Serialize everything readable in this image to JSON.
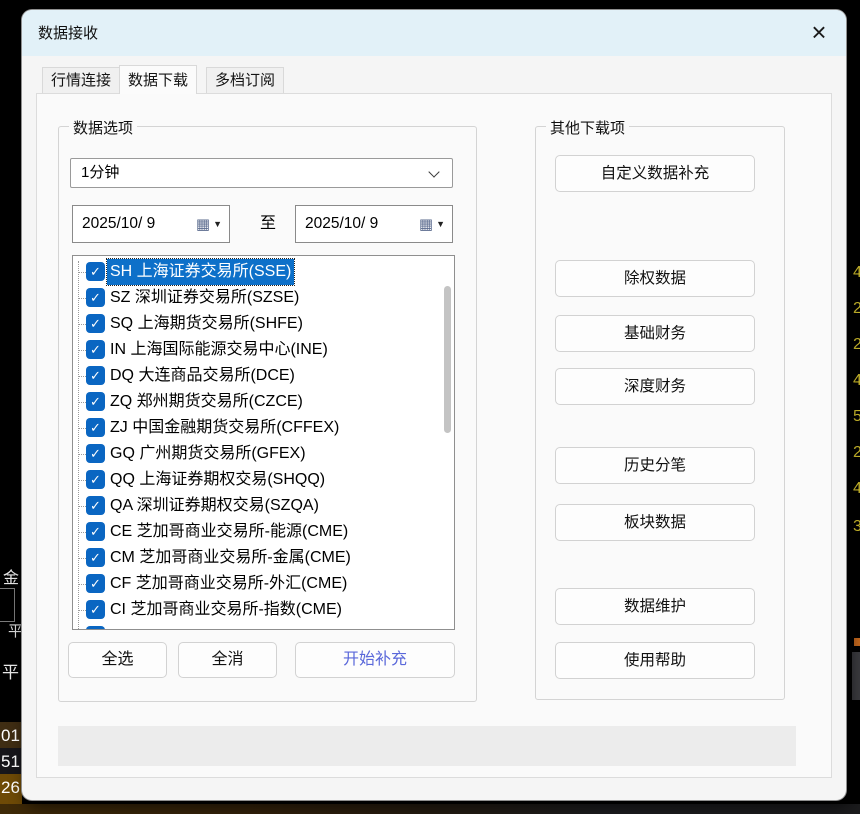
{
  "window": {
    "title": "数据接收",
    "close_glyph": "×"
  },
  "tabs": {
    "items": [
      {
        "label": "行情连接",
        "active": false
      },
      {
        "label": "数据下载",
        "active": true
      },
      {
        "label": "多档订阅",
        "active": false
      }
    ]
  },
  "data_options": {
    "legend": "数据选项",
    "period": {
      "value": "1分钟"
    },
    "dates": {
      "from": "2025/10/ 9",
      "to_label": "至",
      "to": "2025/10/ 9"
    },
    "exchanges": [
      {
        "label": "SH 上海证券交易所(SSE)",
        "checked": true,
        "selected": true
      },
      {
        "label": "SZ 深圳证券交易所(SZSE)",
        "checked": true,
        "selected": false
      },
      {
        "label": "SQ 上海期货交易所(SHFE)",
        "checked": true,
        "selected": false
      },
      {
        "label": "IN 上海国际能源交易中心(INE)",
        "checked": true,
        "selected": false
      },
      {
        "label": "DQ 大连商品交易所(DCE)",
        "checked": true,
        "selected": false
      },
      {
        "label": "ZQ 郑州期货交易所(CZCE)",
        "checked": true,
        "selected": false
      },
      {
        "label": "ZJ 中国金融期货交易所(CFFEX)",
        "checked": true,
        "selected": false
      },
      {
        "label": "GQ 广州期货交易所(GFEX)",
        "checked": true,
        "selected": false
      },
      {
        "label": "QQ 上海证券期权交易(SHQQ)",
        "checked": true,
        "selected": false
      },
      {
        "label": "QA 深圳证券期权交易(SZQA)",
        "checked": true,
        "selected": false
      },
      {
        "label": "CE 芝加哥商业交易所-能源(CME)",
        "checked": true,
        "selected": false
      },
      {
        "label": "CM 芝加哥商业交易所-金属(CME)",
        "checked": true,
        "selected": false
      },
      {
        "label": "CF 芝加哥商业交易所-外汇(CME)",
        "checked": true,
        "selected": false
      },
      {
        "label": "CI 芝加哥商业交易所-指数(CME)",
        "checked": true,
        "selected": false
      }
    ],
    "actions": {
      "select_all": "全选",
      "clear_all": "全消",
      "start": "开始补充"
    }
  },
  "other_downloads": {
    "legend": "其他下载项",
    "buttons": [
      "自定义数据补充",
      "除权数据",
      "基础财务",
      "深度财务",
      "历史分笔",
      "板块数据",
      "数据维护",
      "使用帮助"
    ]
  },
  "background": {
    "left_fragments": [
      "金",
      "平",
      "平",
      "01",
      "51",
      "26"
    ],
    "right_fragments": [
      "4",
      "2",
      "2",
      "4",
      "5",
      "2",
      "4",
      "3"
    ]
  },
  "colors": {
    "titlebar": "#e2f1f8",
    "checkbox_blue": "#0a66c2",
    "selection_blue": "#0d70c9",
    "start_button_text": "#5a68da",
    "fragment_yellow": "#d6c32e"
  }
}
